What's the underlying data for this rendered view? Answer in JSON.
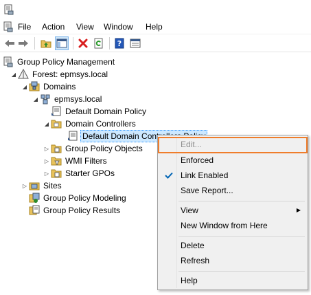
{
  "menubar": {
    "items": [
      "File",
      "Action",
      "View",
      "Window",
      "Help"
    ]
  },
  "toolbar": {
    "buttons": [
      "back-arrow-icon",
      "forward-arrow-icon",
      "up-folder-icon",
      "show-hide-tree-icon",
      "delete-icon",
      "refresh-icon",
      "help-icon",
      "properties-icon"
    ]
  },
  "tree": {
    "root": "Group Policy Management",
    "forest": "Forest: epmsys.local",
    "domains": "Domains",
    "domain": "epmsys.local",
    "default_domain_policy": "Default Domain Policy",
    "domain_controllers": "Domain Controllers",
    "default_dc_policy": "Default Domain Controllers Policy",
    "gpo_objects": "Group Policy Objects",
    "wmi_filters": "WMI Filters",
    "starter_gpos": "Starter GPOs",
    "sites": "Sites",
    "gp_modeling": "Group Policy Modeling",
    "gp_results": "Group Policy Results"
  },
  "context_menu": {
    "edit": "Edit...",
    "enforced": "Enforced",
    "link_enabled": "Link Enabled",
    "link_enabled_checked": true,
    "save_report": "Save Report...",
    "view": "View",
    "new_window": "New Window from Here",
    "delete": "Delete",
    "refresh": "Refresh",
    "help": "Help"
  },
  "colors": {
    "highlight_border": "#ef7d2b",
    "selection_bg": "#cce8ff",
    "check_color": "#0064b4"
  }
}
